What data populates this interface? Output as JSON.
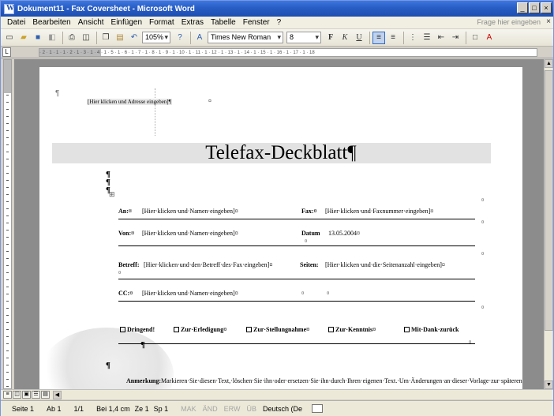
{
  "window": {
    "title": "Dokument11 - Fax Coversheet - Microsoft Word",
    "buttons": {
      "minimize": "_",
      "restore": "□",
      "close": "×"
    }
  },
  "menubar": {
    "items": [
      {
        "label": "Datei"
      },
      {
        "label": "Bearbeiten"
      },
      {
        "label": "Ansicht"
      },
      {
        "label": "Einfügen"
      },
      {
        "label": "Format"
      },
      {
        "label": "Extras"
      },
      {
        "label": "Tabelle"
      },
      {
        "label": "Fenster"
      },
      {
        "label": "?"
      }
    ],
    "help_placeholder": "Frage hier eingeben",
    "close_glyph": "×"
  },
  "toolbar": {
    "zoom": "105%",
    "font": "Times New Roman",
    "font_size": "8",
    "bold": "F",
    "italic": "K",
    "underline": "U"
  },
  "ruler": {
    "marks": "· 2 · 1 · 1 · 1 · 2 · 1 · 3 · 1 · 4 · 1 · 5 · 1 · 6 · 1 · 7 · 1 · 8 · 1 · 9 · 1 · 10 · 1 · 11 · 1 · 12 · 1 · 13 · 1 · 14 · 1 · 15 · 1 · 16 · 1 · 17 · 1 · 18"
  },
  "document": {
    "top_pilcrow": "¶",
    "address_field": "[Hier klicken und Adresse eingeben]¶",
    "address_end": "¤",
    "title": "Telefax-Deckblatt¶",
    "pilcrow": "¶",
    "table_marker": "⊞",
    "fields": {
      "an_label": "An:¤",
      "an_value": "[Hier·klicken·und·Namen·eingeben]¤",
      "fax_label": "Fax:¤",
      "fax_value": "[Hier·klicken·und·Faxnummer·eingeben]¤",
      "von_label": "Von:¤",
      "von_value": "[Hier·klicken·und·Namen·eingeben]¤",
      "datum_label": "Datum",
      "datum_value": "13.05.2004¤",
      "betreff_label": "Betreff:",
      "betreff_value": "[Hier·klicken·und·den·Betreff·des·Fax·eingeben]¤",
      "seiten_label": "Seiten:",
      "seiten_value": "[Hier·klicken·und·die·Seitenanzahl·eingeben]¤",
      "cc_label": "CC:¤",
      "cc_value": "[Hier·klicken·und·Namen·eingeben]¤",
      "cell_end": "¤"
    },
    "checkboxes": [
      {
        "label": "Dringend!"
      },
      {
        "label": "Zur·Erledigung¤"
      },
      {
        "label": "Zur·Stellungnahme¤"
      },
      {
        "label": "Zur·Kenntnis¤"
      },
      {
        "label": "Mit·Dank·zurück"
      }
    ],
    "note_label": "Anmerkung:",
    "note_text": "Markieren·Sie·diesen·Text,·löschen·Sie·ihn·oder·ersetzen·Sie·ihn·durch·Ihren·eigenen·Text.·Um·Änderungen·an·dieser·Vorlage·zur·späteren·Verwendung·zu·speichern,·klicken·Sie·im·Menü·Datei·auf·Speichern·unter.·Wählen·Sie·im·Feld·Dateityp·den·Eintrag·Dokumentvorlage·aus."
  },
  "statusbar": {
    "page": "Seite 1",
    "section": "Ab 1",
    "pages": "1/1",
    "position": "Bei 1,4 cm",
    "line": "Ze 1",
    "column": "Sp 1",
    "mak": "MAK",
    "aend": "ÄND",
    "erw": "ERW",
    "ub": "ÜB",
    "language": "Deutsch (De"
  }
}
